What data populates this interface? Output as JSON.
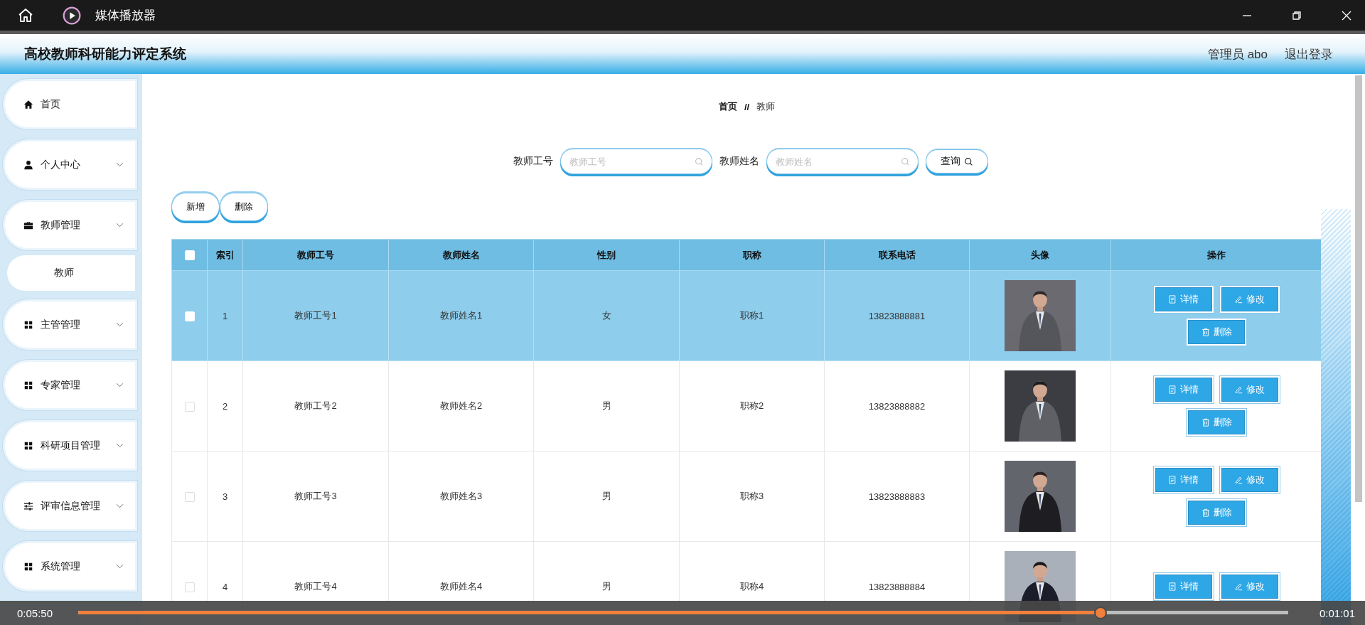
{
  "window": {
    "title": "媒体播放器"
  },
  "app": {
    "title": "高校教师科研能力评定系统",
    "user": "管理员 abo",
    "logout": "退出登录"
  },
  "sidebar": {
    "items": [
      {
        "label": "首页",
        "kind": "link"
      },
      {
        "label": "个人中心",
        "kind": "menu"
      },
      {
        "label": "教师管理",
        "kind": "menu",
        "children": [
          {
            "label": "教师"
          }
        ]
      },
      {
        "label": "主管管理",
        "kind": "menu"
      },
      {
        "label": "专家管理",
        "kind": "menu"
      },
      {
        "label": "科研项目管理",
        "kind": "menu"
      },
      {
        "label": "评审信息管理",
        "kind": "menu"
      },
      {
        "label": "系统管理",
        "kind": "menu"
      }
    ]
  },
  "breadcrumb": {
    "items": [
      "首页",
      "教师"
    ],
    "separator": "//"
  },
  "search": {
    "fields": [
      {
        "label": "教师工号",
        "placeholder": "教师工号"
      },
      {
        "label": "教师姓名",
        "placeholder": "教师姓名"
      }
    ],
    "button": "查询"
  },
  "toolbar": [
    "新增",
    "删除"
  ],
  "table": {
    "select_all_checked": false,
    "columns": [
      "索引",
      "教师工号",
      "教师姓名",
      "性别",
      "职称",
      "联系电话",
      "头像",
      "操作"
    ],
    "rows": [
      {
        "selected": true,
        "checked": false,
        "cells": [
          "1",
          "教师工号1",
          "教师姓名1",
          "女",
          "职称1",
          "13823888881"
        ],
        "photo": {
          "kind": "picture"
        },
        "actions": [
          "详情",
          "修改",
          "删除"
        ]
      },
      {
        "selected": false,
        "checked": false,
        "cells": [
          "2",
          "教师工号2",
          "教师姓名2",
          "男",
          "职称2",
          "13823888882"
        ],
        "photo": {
          "kind": "picture"
        },
        "actions": [
          "详情",
          "修改",
          "删除"
        ]
      },
      {
        "selected": false,
        "checked": false,
        "cells": [
          "3",
          "教师工号3",
          "教师姓名3",
          "男",
          "职称3",
          "13823888883"
        ],
        "photo": {
          "kind": "picture"
        },
        "actions": [
          "详情",
          "修改",
          "删除"
        ]
      },
      {
        "selected": false,
        "checked": false,
        "cells": [
          "4",
          "教师工号4",
          "教师姓名4",
          "男",
          "职称4",
          "13823888884"
        ],
        "photo": {
          "kind": "picture"
        },
        "actions": [
          "详情",
          "修改"
        ]
      }
    ]
  },
  "player": {
    "elapsed": "0:05:50",
    "remaining": "0:01:01",
    "level": 0.845
  }
}
